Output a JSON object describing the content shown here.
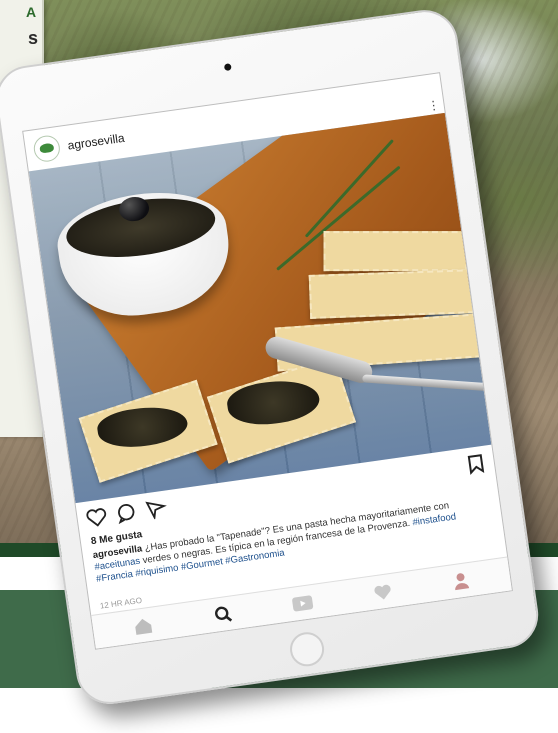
{
  "background": {
    "side_card_lines": [
      "A",
      "s"
    ]
  },
  "post": {
    "username": "agrosevilla",
    "likes": "8 Me gusta",
    "caption_user": "agrosevilla",
    "caption_lead": " ¿Has probado la \"Tapenade\"? Es una pasta hecha mayoritariamente con ",
    "caption_tag1": "#aceitunas",
    "caption_mid": " verdes o negras. Es típica en la región francesa de la Provenza. ",
    "caption_tag2": "#instafood",
    "caption_tag3": "#Francia",
    "caption_tag4": "#riquisimo",
    "caption_tag5": "#Gourmet",
    "caption_tag6": "#Gastronomia",
    "timestamp": "12 HR AGO"
  },
  "icons": {
    "post_actions": [
      "heart-icon",
      "comment-icon",
      "share-icon",
      "bookmark-icon"
    ],
    "nav": [
      "home-icon",
      "search-icon",
      "video-icon",
      "heart-icon",
      "profile-icon"
    ]
  },
  "colors": {
    "dark_band": "#1f4a28",
    "green_band": "#3f6b4a",
    "hashtag": "#1c4f8c",
    "side_card_accent": "#2c6a2c"
  }
}
